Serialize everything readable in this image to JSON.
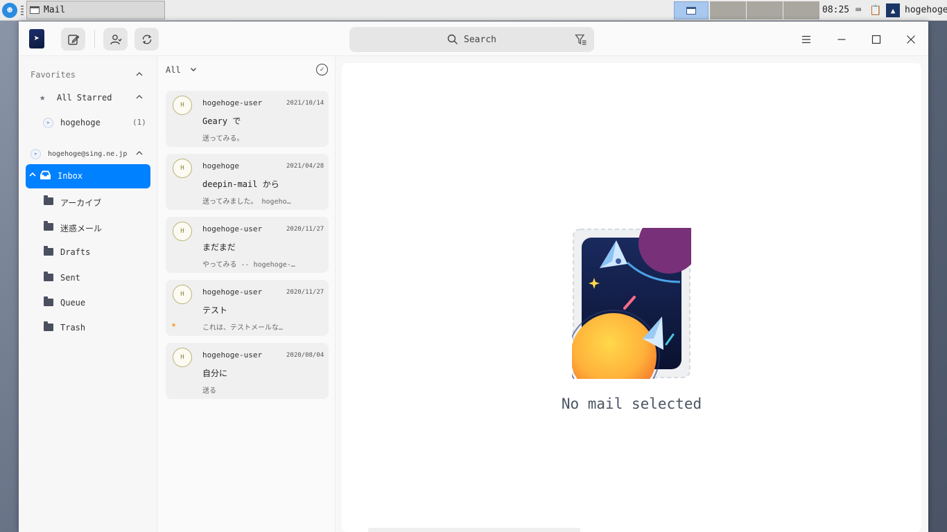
{
  "taskbar": {
    "task_title": "Mail",
    "clock": "08:25",
    "user": "hogehoge"
  },
  "toolbar": {
    "search_placeholder": "Search"
  },
  "sidebar": {
    "favorites_label": "Favorites",
    "all_starred_label": "All Starred",
    "hogehoge_label": "hogehoge",
    "hogehoge_count": "(1)",
    "account_label": "hogehoge@sing.ne.jp",
    "inbox_label": "Inbox",
    "folders": [
      {
        "label": "アーカイブ"
      },
      {
        "label": "迷惑メール"
      },
      {
        "label": "Drafts"
      },
      {
        "label": "Sent"
      },
      {
        "label": "Queue"
      },
      {
        "label": "Trash"
      }
    ]
  },
  "list": {
    "filter_label": "All",
    "messages": [
      {
        "avatar": "H",
        "sender": "hogehoge-user",
        "date": "2021/10/14",
        "subject": "Geary で",
        "preview": "送ってみる。",
        "starred": false
      },
      {
        "avatar": "H",
        "sender": "hogehoge",
        "date": "2021/04/28",
        "subject": "deepin-mail から",
        "preview": "送ってみました。 hogeho…",
        "starred": false
      },
      {
        "avatar": "H",
        "sender": "hogehoge-user",
        "date": "2020/11/27",
        "subject": "まだまだ",
        "preview": "やってみる -- hogehoge-…",
        "starred": false
      },
      {
        "avatar": "H",
        "sender": "hogehoge-user",
        "date": "2020/11/27",
        "subject": "テスト",
        "preview": "これは、テストメールな…",
        "starred": true
      },
      {
        "avatar": "H",
        "sender": "hogehoge-user",
        "date": "2020/08/04",
        "subject": "自分に",
        "preview": "送る",
        "starred": false
      }
    ]
  },
  "detail": {
    "empty_text": "No mail selected"
  },
  "colors": {
    "accent": "#0081ff",
    "star": "#f59a23"
  }
}
